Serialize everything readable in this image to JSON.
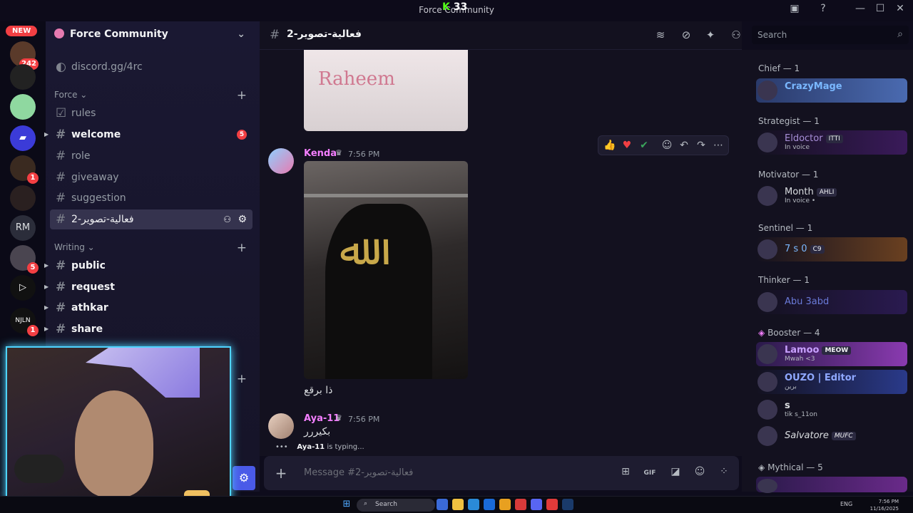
{
  "window": {
    "title": "Force Community",
    "kick_count": "33"
  },
  "servers": {
    "new_label": "NEW",
    "items": [
      {
        "badge": "242"
      },
      {
        "badge": ""
      },
      {
        "badge": ""
      },
      {
        "badge": ""
      },
      {
        "badge": "1"
      },
      {
        "badge": ""
      },
      {
        "label": "RM",
        "badge": ""
      },
      {
        "badge": "5"
      },
      {
        "badge": ""
      },
      {
        "badge": "1"
      }
    ]
  },
  "sidebar": {
    "guild_name": "Force Community",
    "invite": "discord.gg/4rc",
    "categories": [
      {
        "label": "Force"
      },
      {
        "label": "Writing"
      }
    ],
    "channels": [
      {
        "label": "rules"
      },
      {
        "label": "welcome",
        "badge": "5"
      },
      {
        "label": "role"
      },
      {
        "label": "giveaway"
      },
      {
        "label": "suggestion"
      },
      {
        "label": "2-فعالية-تصوير"
      },
      {
        "label": "public"
      },
      {
        "label": "request"
      },
      {
        "label": "athkar"
      },
      {
        "label": "share"
      }
    ]
  },
  "header": {
    "channel": "2-فعالية-تصوير",
    "search_placeholder": "Search"
  },
  "messages": [
    {
      "author": "Kenda",
      "time": "7:56 PM",
      "text": "ذا برقع",
      "author_color": "#f47fff"
    },
    {
      "author": "Aya-11",
      "time": "7:56 PM",
      "text": "بكيررر",
      "author_color": "#f47fff"
    }
  ],
  "image_text": "Raheem",
  "typing": {
    "user": "Aya-11",
    "text": "is typing..."
  },
  "composer": {
    "placeholder": "Message #2-فعالية-تصوير",
    "gif_label": "GIF"
  },
  "members": {
    "groups": [
      {
        "label": "Chief — 1"
      },
      {
        "label": "Strategist — 1"
      },
      {
        "label": "Motivator — 1"
      },
      {
        "label": "Sentinel — 1"
      },
      {
        "label": "Thinker — 1"
      },
      {
        "label": "Booster — 4"
      },
      {
        "label": "Mythical — 5"
      }
    ],
    "list": [
      {
        "name": "CrazyMage",
        "status": "",
        "tag": "",
        "color": "#7ab8ff"
      },
      {
        "name": "Eldoctor",
        "status": "In voice",
        "tag": "ITTI",
        "color": "#a88fd8"
      },
      {
        "name": "Month",
        "status": "In voice •",
        "tag": "AHLI",
        "color": "#dbdee1"
      },
      {
        "name": "7 s 0",
        "status": "",
        "tag": "C9",
        "color": "#7ab8ff"
      },
      {
        "name": "Abu 3abd",
        "status": "",
        "tag": "",
        "color": "#6a7ad8"
      },
      {
        "name": "Lamoo",
        "status": "Mwah <3",
        "tag": "MEOW",
        "color": "#c8a0ff"
      },
      {
        "name": "OUZO | Editor",
        "status": "برين",
        "tag": "",
        "color": "#8fa8ff"
      },
      {
        "name": "s",
        "status": "tik s_11on",
        "tag": "",
        "color": "#dbdee1"
      },
      {
        "name": "Salvatore",
        "status": "",
        "tag": "MUFC",
        "color": "#dbdee1"
      }
    ]
  },
  "taskbar": {
    "search": "Search",
    "lang": "ENG",
    "time": "7:56 PM",
    "date": "11/16/2025"
  }
}
